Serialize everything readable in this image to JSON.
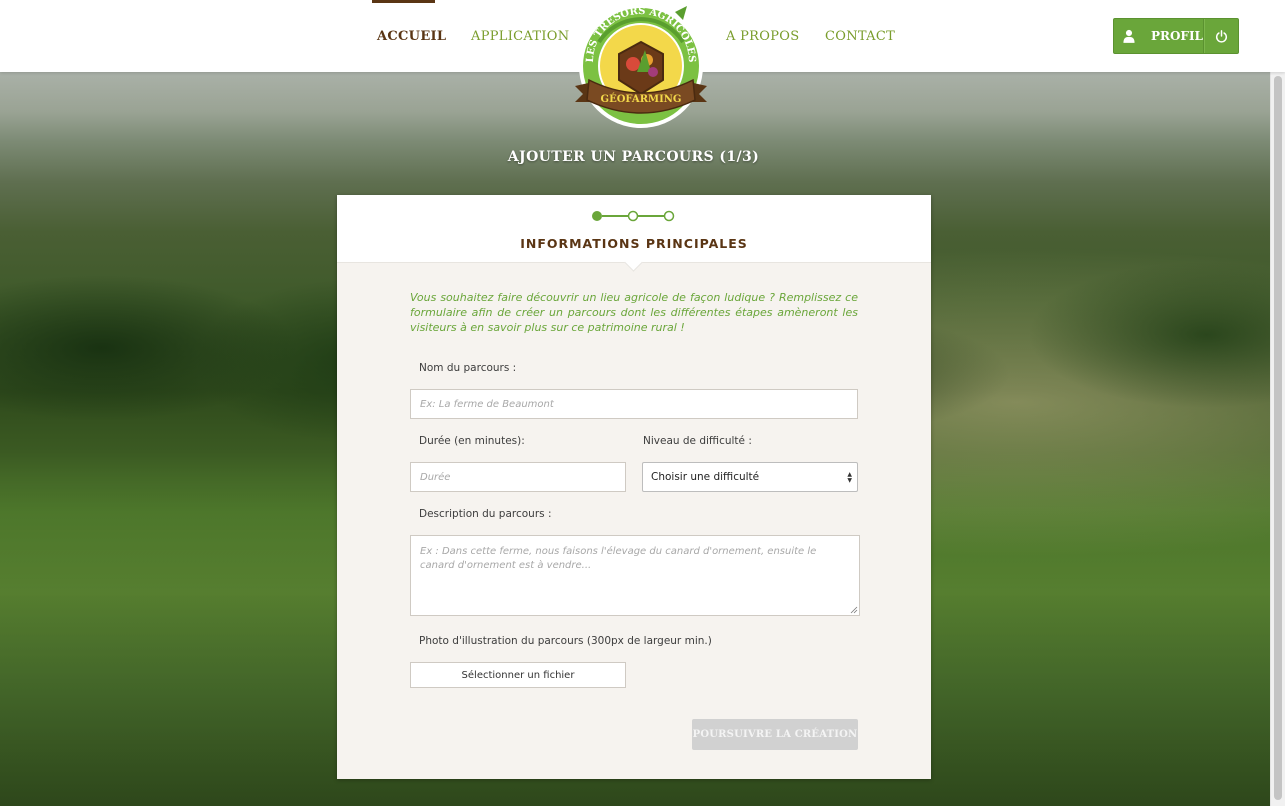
{
  "nav": {
    "items": [
      {
        "label": "ACCUEIL"
      },
      {
        "label": "APPLICATION"
      },
      {
        "label": "A PROPOS"
      },
      {
        "label": "CONTACT"
      }
    ]
  },
  "logo": {
    "top_text": "LES TRÉSORS AGRICOLES",
    "banner_text": "GÉOFARMING"
  },
  "profile": {
    "label": "PROFIL",
    "icon": "user-icon",
    "power_icon": "power-icon"
  },
  "page": {
    "title": "AJOUTER UN PARCOURS (1/3)"
  },
  "card": {
    "step_title": "INFORMATIONS PRINCIPALES",
    "steps": {
      "total": 3,
      "current": 1
    },
    "intro": "Vous souhaitez faire découvrir un lieu agricole de façon ludique ? Remplissez ce formulaire afin de créer un parcours dont les différentes étapes amèneront les visiteurs à en savoir plus sur ce patrimoine rural !",
    "fields": {
      "name": {
        "label": "Nom du parcours :",
        "placeholder": "Ex: La ferme de Beaumont",
        "value": ""
      },
      "duration": {
        "label": "Durée (en minutes):",
        "placeholder": "Durée",
        "value": ""
      },
      "difficulty": {
        "label": "Niveau de difficulté :",
        "selected": "Choisir une difficulté"
      },
      "description": {
        "label": "Description du parcours :",
        "placeholder": "Ex : Dans cette ferme, nous faisons l'élevage du canard d'ornement, ensuite le canard d'ornement est à vendre..."
      },
      "photo": {
        "label": "Photo d'illustration du parcours (300px de largeur min.)",
        "button": "Sélectionner un fichier"
      }
    },
    "submit": "POURSUIVRE LA CRÉATION"
  },
  "colors": {
    "accent_green": "#6aa63a",
    "brown": "#5a3514",
    "disabled_button": "#d1d1d1"
  }
}
